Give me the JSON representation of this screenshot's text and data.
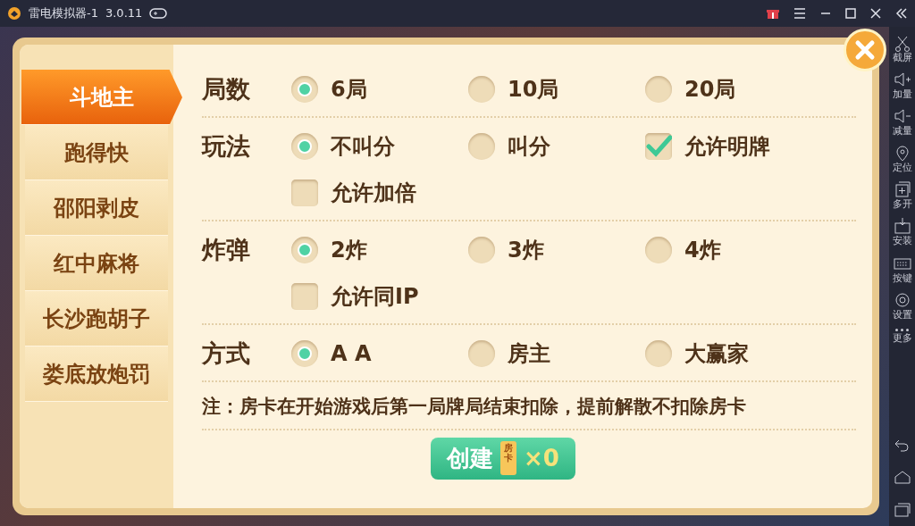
{
  "window": {
    "title": "雷电模拟器-1",
    "version": "3.0.11"
  },
  "game_tabs": [
    {
      "label": "斗地主",
      "selected": true
    },
    {
      "label": "跑得快",
      "selected": false
    },
    {
      "label": "邵阳剥皮",
      "selected": false
    },
    {
      "label": "红中麻将",
      "selected": false
    },
    {
      "label": "长沙跑胡子",
      "selected": false
    },
    {
      "label": "娄底放炮罚",
      "selected": false
    }
  ],
  "sections": [
    {
      "label": "局数",
      "options": [
        {
          "kind": "radio",
          "label": "6局",
          "selected": true
        },
        {
          "kind": "radio",
          "label": "10局",
          "selected": false
        },
        {
          "kind": "radio",
          "label": "20局",
          "selected": false
        }
      ]
    },
    {
      "label": "玩法",
      "options": [
        {
          "kind": "radio",
          "label": "不叫分",
          "selected": true
        },
        {
          "kind": "radio",
          "label": "叫分",
          "selected": false
        },
        {
          "kind": "checkbox",
          "label": "允许明牌",
          "checked": true
        },
        {
          "kind": "checkbox",
          "label": "允许加倍",
          "checked": false
        }
      ]
    },
    {
      "label": "炸弹",
      "options": [
        {
          "kind": "radio",
          "label": "2炸",
          "selected": true
        },
        {
          "kind": "radio",
          "label": "3炸",
          "selected": false
        },
        {
          "kind": "radio",
          "label": "4炸",
          "selected": false
        },
        {
          "kind": "checkbox",
          "label": "允许同IP",
          "checked": false
        }
      ]
    },
    {
      "label": "方式",
      "options": [
        {
          "kind": "radio",
          "label": "A A",
          "selected": true
        },
        {
          "kind": "radio",
          "label": "房主",
          "selected": false
        },
        {
          "kind": "radio",
          "label": "大赢家",
          "selected": false
        }
      ]
    }
  ],
  "note": "注：房卡在开始游戏后第一局牌局结束扣除，提前解散不扣除房卡",
  "create_button": {
    "label": "创建",
    "card_label": "房卡",
    "count": "×0"
  },
  "sidebar_tools": [
    {
      "label": "截屏"
    },
    {
      "label": "加量"
    },
    {
      "label": "减量"
    },
    {
      "label": "定位"
    },
    {
      "label": "多开"
    },
    {
      "label": "安装"
    },
    {
      "label": "按键"
    },
    {
      "label": "设置"
    },
    {
      "label": "更多"
    }
  ]
}
